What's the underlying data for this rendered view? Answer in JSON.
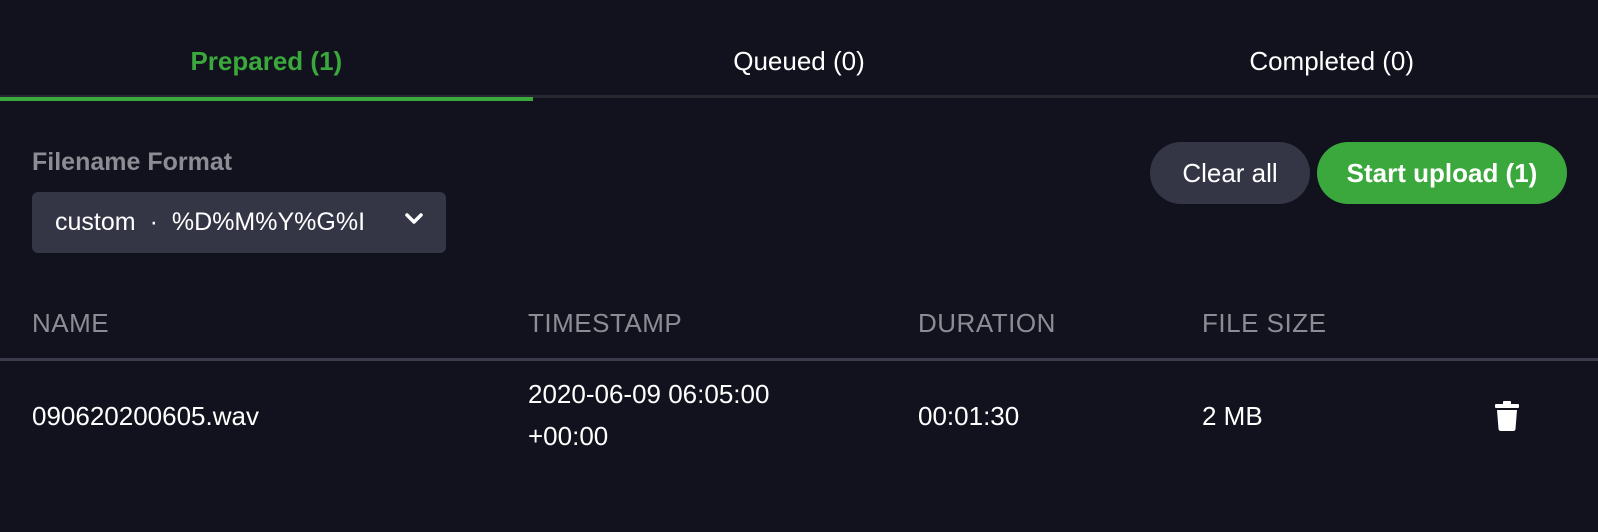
{
  "tabs": [
    {
      "label": "Prepared (1)",
      "active": true
    },
    {
      "label": "Queued (0)",
      "active": false
    },
    {
      "label": "Completed (0)",
      "active": false
    }
  ],
  "filename_format": {
    "label": "Filename Format",
    "mode": "custom",
    "separator": "·",
    "pattern": "%D%M%Y%G%I",
    "icon": "chevron-down-icon"
  },
  "actions": {
    "clear_label": "Clear all",
    "start_label": "Start upload (1)"
  },
  "table": {
    "columns": [
      "NAME",
      "TIMESTAMP",
      "DURATION",
      "FILE SIZE"
    ],
    "rows": [
      {
        "name": "090620200605.wav",
        "timestamp_line1": "2020-06-09 06:05:00",
        "timestamp_line2": "+00:00",
        "duration": "00:01:30",
        "file_size": "2 MB",
        "action_icon": "trash-icon"
      }
    ]
  },
  "colors": {
    "background": "#11121d",
    "accent": "#3aa83c",
    "surface": "#343646",
    "muted_text": "#8c8d94"
  }
}
